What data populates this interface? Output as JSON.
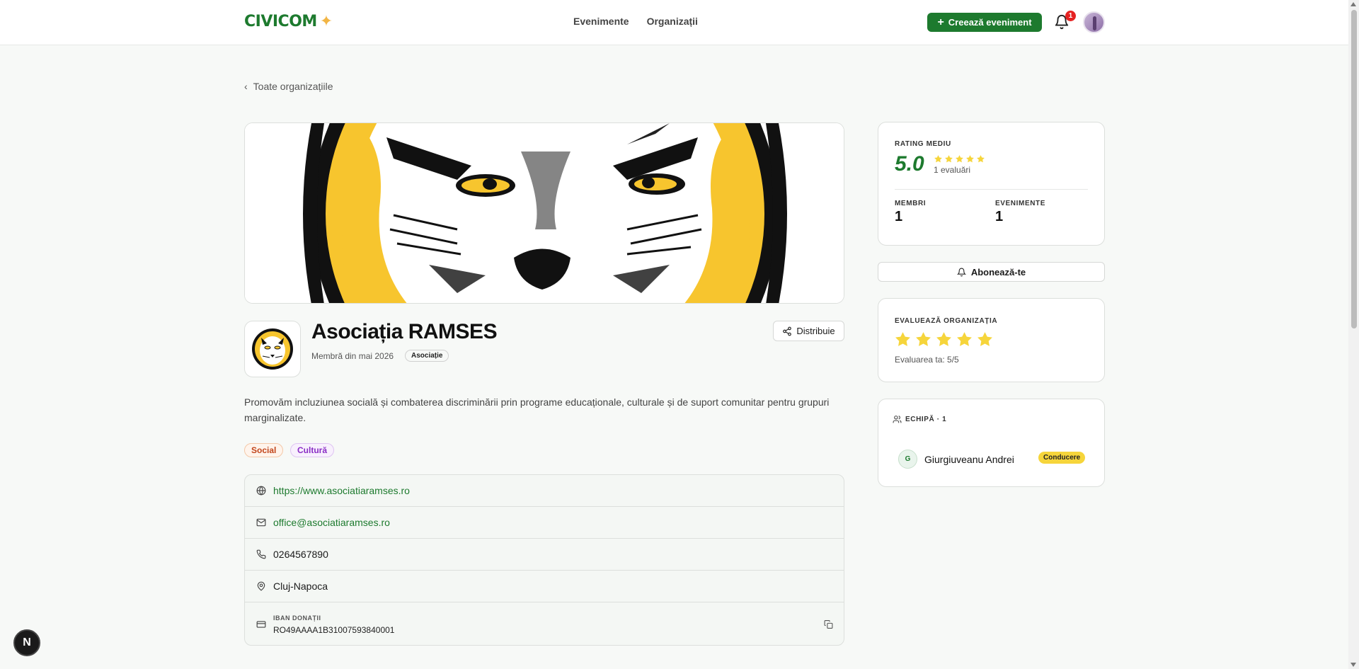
{
  "header": {
    "logo": "CIVICOM",
    "nav": [
      "Evenimente",
      "Organizații"
    ],
    "create_label": "Creează eveniment",
    "notification_count": "1"
  },
  "back_label": "Toate organizațiile",
  "org": {
    "name": "Asociația RAMSES",
    "member_since": "Membră din mai 2026",
    "type": "Asociație",
    "share_label": "Distribuie",
    "description": "Promovăm incluziunea socială și combaterea discriminării prin programe educaționale, culturale și de suport comunitar pentru grupuri marginalizate.",
    "tags": [
      "Social",
      "Cultură"
    ]
  },
  "contact": {
    "website": "https://www.asociatiaramses.ro",
    "email": "office@asociatiaramses.ro",
    "phone": "0264567890",
    "city": "Cluj-Napoca",
    "iban_label": "IBAN DONAȚII",
    "iban": "RO49AAAA1B31007593840001"
  },
  "rating": {
    "label": "RATING MEDIU",
    "value": "5.0",
    "stars_filled": 5,
    "count_text": "1 evaluări",
    "members_label": "MEMBRI",
    "members": "1",
    "events_label": "EVENIMENTE",
    "events": "1"
  },
  "subscribe_label": "Abonează-te",
  "evaluate": {
    "label": "EVALUEAZĂ ORGANIZAȚIA",
    "user_rating": 5,
    "text": "Evaluarea ta: 5/5"
  },
  "team": {
    "label": "ECHIPĂ · 1",
    "members": [
      {
        "initial": "G",
        "name": "Giurgiuveanu Andrei",
        "role": "Conducere"
      }
    ]
  },
  "dev_badge": "N",
  "colors": {
    "brand": "#1d7a2e",
    "star": "#f6d53b",
    "badge_red": "#e52222"
  }
}
